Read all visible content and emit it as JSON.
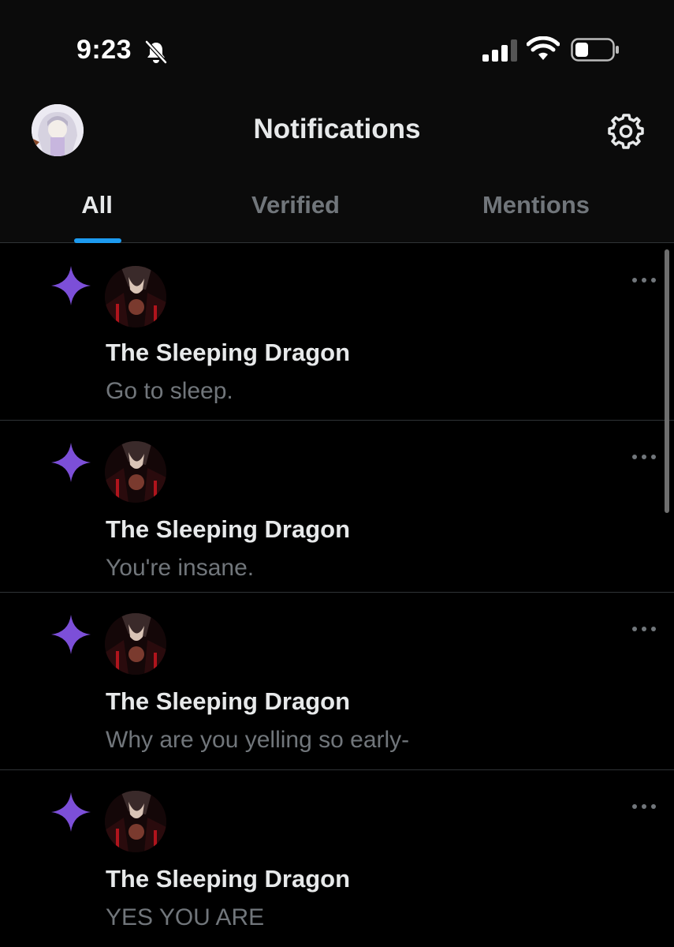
{
  "status_bar": {
    "time": "9:23",
    "icons": [
      "bell-slash-icon",
      "cellular-signal-icon",
      "wifi-icon",
      "battery-icon"
    ]
  },
  "header": {
    "title": "Notifications",
    "settings_icon": "gear-icon"
  },
  "tabs": [
    {
      "label": "All",
      "active": true
    },
    {
      "label": "Verified",
      "active": false
    },
    {
      "label": "Mentions",
      "active": false
    }
  ],
  "notifications": [
    {
      "icon": "sparkle-icon",
      "name": "The Sleeping Dragon",
      "text": "Go to sleep."
    },
    {
      "icon": "sparkle-icon",
      "name": "The Sleeping Dragon",
      "text": "You're insane."
    },
    {
      "icon": "sparkle-icon",
      "name": "The Sleeping Dragon",
      "text": "Why are you yelling so early-"
    },
    {
      "icon": "sparkle-icon",
      "name": "The Sleeping Dragon",
      "text": "YES YOU ARE"
    }
  ],
  "colors": {
    "background": "#000000",
    "header_bg": "#0b0b0b",
    "accent": "#1d9bf0",
    "sparkle": "#7c4fd8",
    "secondary_text": "#71767b",
    "divider": "#2f3336"
  }
}
